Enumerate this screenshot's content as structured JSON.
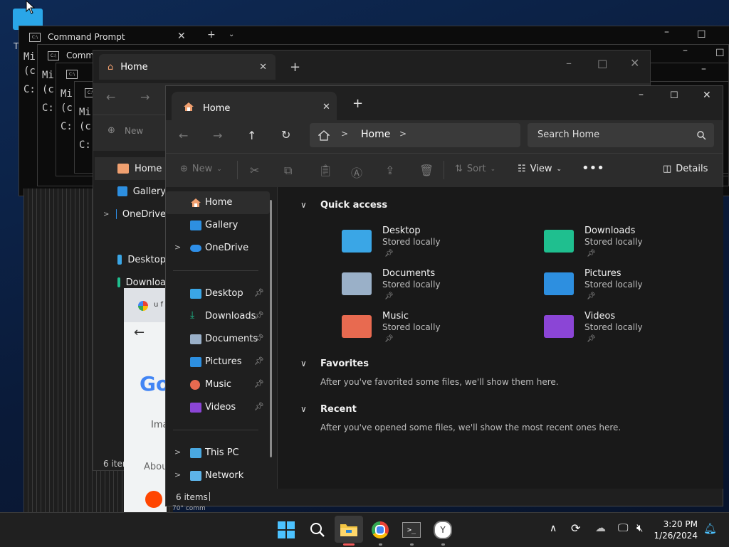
{
  "colors": {
    "accent": "#0078d4",
    "folder_desktop": "#3aa6e6",
    "folder_downloads": "#1fbf8f",
    "folder_documents": "#9ab0c8",
    "folder_pictures": "#2d8fe0",
    "folder_music": "#e86a50",
    "folder_videos": "#8b45d6"
  },
  "desktop": {
    "letter": "T"
  },
  "cmd_windows": [
    {
      "title": "Command Prompt",
      "line1": "Mi",
      "line2": "(c",
      "line3": "C:"
    },
    {
      "title": "Comma",
      "line1": "Mi",
      "line2": "(c",
      "line3": "C:"
    },
    {
      "line1": "Mi",
      "line2": "(c",
      "line3": "C:"
    },
    {
      "line1": "Mi",
      "line2": "(c",
      "line3": "C:"
    }
  ],
  "mid_explorer": {
    "tab_title": "Home",
    "new_label": "New",
    "sidebar": [
      "Home",
      "Gallery",
      "OneDrive",
      "Desktop",
      "Downloa"
    ],
    "status": "6 item"
  },
  "chrome": {
    "tab_text": "u f",
    "logo": "Go",
    "search_text": "Ima",
    "about": "Abou"
  },
  "main_explorer": {
    "tab_title": "Home",
    "breadcrumb": "Home",
    "search_placeholder": "Search Home",
    "toolbar": {
      "new": "New",
      "sort": "Sort",
      "view": "View",
      "details": "Details"
    },
    "sidebar": {
      "top": [
        "Home",
        "Gallery",
        "OneDrive"
      ],
      "pinned": [
        "Desktop",
        "Downloads",
        "Documents",
        "Pictures",
        "Music",
        "Videos"
      ],
      "bottom": [
        "This PC",
        "Network"
      ]
    },
    "quick_access": {
      "title": "Quick access",
      "items": [
        {
          "name": "Desktop",
          "sub": "Stored locally"
        },
        {
          "name": "Downloads",
          "sub": "Stored locally"
        },
        {
          "name": "Documents",
          "sub": "Stored locally"
        },
        {
          "name": "Pictures",
          "sub": "Stored locally"
        },
        {
          "name": "Music",
          "sub": "Stored locally"
        },
        {
          "name": "Videos",
          "sub": "Stored locally"
        }
      ]
    },
    "favorites": {
      "title": "Favorites",
      "message": "After you've favorited some files, we'll show them here."
    },
    "recent": {
      "title": "Recent",
      "message": "After you've opened some files, we'll show the most recent ones here."
    },
    "status": "6 items",
    "status_extra": "70° comm"
  },
  "taskbar": {
    "time": "3:20 PM",
    "date": "1/26/2024"
  }
}
